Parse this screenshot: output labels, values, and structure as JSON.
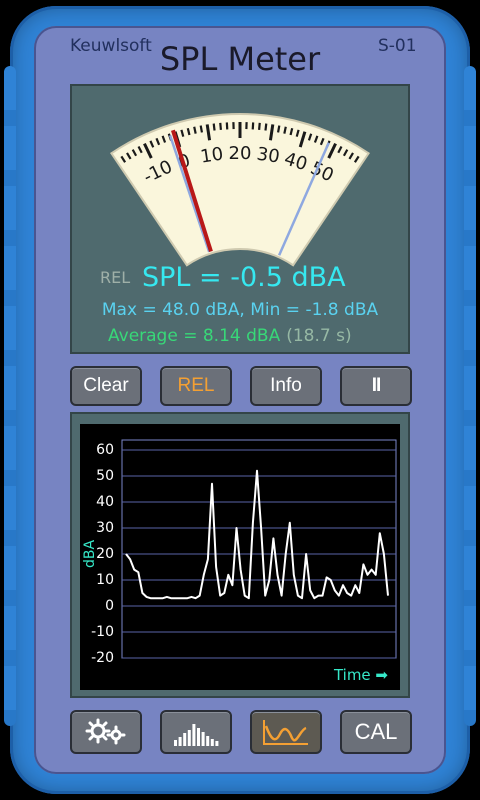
{
  "header": {
    "brand": "Keuwlsoft",
    "title": "SPL Meter",
    "model": "S-01"
  },
  "meter": {
    "scale_labels": [
      "-10",
      "0",
      "10",
      "20",
      "30",
      "40",
      "50"
    ],
    "needle_value": -0.5,
    "max_marker": 48.0,
    "min_marker": -1.8
  },
  "readout": {
    "rel_tag": "REL",
    "spl": "SPL = -0.5 dBA",
    "maxmin": "Max = 48.0 dBA,  Min = -1.8 dBA",
    "average": "Average = 8.14 dBA",
    "duration": "(18.7 s)"
  },
  "controls": {
    "clear": "Clear",
    "rel": "REL",
    "info": "Info",
    "pause": "II"
  },
  "chart_data": {
    "type": "line",
    "ylabel": "dBA",
    "xlabel": "Time ➡",
    "ylim": [
      -20,
      60
    ],
    "yticks": [
      "60",
      "50",
      "40",
      "30",
      "20",
      "10",
      "0",
      "-10",
      "-20"
    ],
    "grid": true,
    "series": [
      {
        "color": "#ffffff",
        "values": [
          20,
          18,
          14,
          13,
          5,
          3.5,
          3,
          3,
          3,
          3,
          3.5,
          3,
          3,
          3,
          3,
          3,
          3.5,
          3,
          4,
          12,
          18,
          47,
          15,
          4,
          5,
          12,
          8,
          30,
          14,
          4,
          3,
          32,
          52,
          30,
          4,
          10,
          26,
          12,
          4,
          20,
          32,
          12,
          4,
          3,
          20,
          6,
          3,
          4,
          4,
          11,
          10,
          6,
          4,
          8,
          5,
          4,
          8,
          5,
          16,
          12,
          14,
          12,
          28,
          20,
          4
        ]
      }
    ],
    "line_color": "#ffffff",
    "time_label_color": "#36e8c8"
  },
  "bottom": {
    "settings_icon": "gears-icon",
    "spectrum_icon": "bar-spectrum-icon",
    "graph_icon": "line-graph-icon",
    "cal": "CAL"
  }
}
